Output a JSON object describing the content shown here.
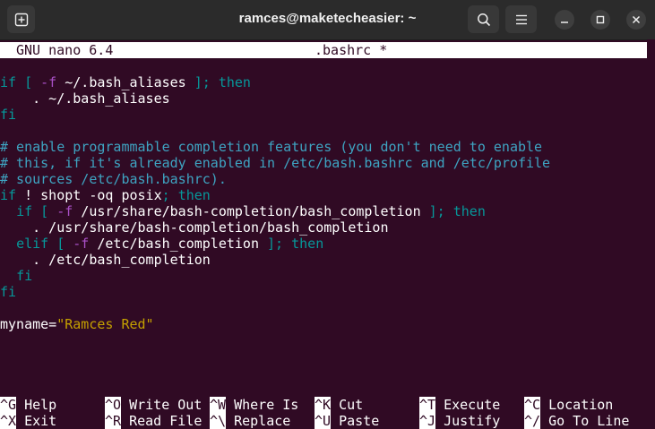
{
  "window": {
    "title": "ramces@maketecheasier: ~"
  },
  "nano": {
    "version_label": "GNU nano 6.4",
    "filename": ".bashrc *"
  },
  "lines": [
    [
      {
        "t": "if",
        "c": "c-kw"
      },
      {
        "t": " "
      },
      {
        "t": "[",
        "c": "c-br"
      },
      {
        "t": " "
      },
      {
        "t": "-f",
        "c": "c-flag"
      },
      {
        "t": " ~/.bash_aliases "
      },
      {
        "t": "];",
        "c": "c-br"
      },
      {
        "t": " "
      },
      {
        "t": "then",
        "c": "c-kw"
      }
    ],
    [
      {
        "t": "    . ~/.bash_aliases"
      }
    ],
    [
      {
        "t": "fi",
        "c": "c-fi"
      }
    ],
    [
      {
        "t": ""
      }
    ],
    [
      {
        "t": "# enable programmable completion features (you don't need to enable",
        "c": "c-cmt"
      }
    ],
    [
      {
        "t": "# this, if it's already enabled in /etc/bash.bashrc and /etc/profile",
        "c": "c-cmt"
      }
    ],
    [
      {
        "t": "# sources /etc/bash.bashrc).",
        "c": "c-cmt"
      }
    ],
    [
      {
        "t": "if",
        "c": "c-kw"
      },
      {
        "t": " ! shopt -oq posix"
      },
      {
        "t": ";",
        "c": "c-br"
      },
      {
        "t": " "
      },
      {
        "t": "then",
        "c": "c-kw"
      }
    ],
    [
      {
        "t": "  "
      },
      {
        "t": "if",
        "c": "c-kw"
      },
      {
        "t": " "
      },
      {
        "t": "[",
        "c": "c-br"
      },
      {
        "t": " "
      },
      {
        "t": "-f",
        "c": "c-flag"
      },
      {
        "t": " /usr/share/bash-completion/bash_completion "
      },
      {
        "t": "];",
        "c": "c-br"
      },
      {
        "t": " "
      },
      {
        "t": "then",
        "c": "c-kw"
      }
    ],
    [
      {
        "t": "    . /usr/share/bash-completion/bash_completion"
      }
    ],
    [
      {
        "t": "  "
      },
      {
        "t": "elif",
        "c": "c-kw"
      },
      {
        "t": " "
      },
      {
        "t": "[",
        "c": "c-br"
      },
      {
        "t": " "
      },
      {
        "t": "-f",
        "c": "c-flag"
      },
      {
        "t": " /etc/bash_completion "
      },
      {
        "t": "];",
        "c": "c-br"
      },
      {
        "t": " "
      },
      {
        "t": "then",
        "c": "c-kw"
      }
    ],
    [
      {
        "t": "    . /etc/bash_completion"
      }
    ],
    [
      {
        "t": "  "
      },
      {
        "t": "fi",
        "c": "c-fi"
      }
    ],
    [
      {
        "t": "fi",
        "c": "c-fi"
      }
    ],
    [
      {
        "t": ""
      }
    ],
    [
      {
        "t": "myname="
      },
      {
        "t": "\"Ramces Red\"",
        "c": "c-str"
      }
    ]
  ],
  "shortcuts": [
    [
      {
        "key": "^G",
        "label": " Help"
      },
      {
        "key": "^O",
        "label": " Write Out"
      },
      {
        "key": "^W",
        "label": " Where Is"
      },
      {
        "key": "^K",
        "label": " Cut"
      },
      {
        "key": "^T",
        "label": " Execute"
      },
      {
        "key": "^C",
        "label": " Location"
      }
    ],
    [
      {
        "key": "^X",
        "label": " Exit"
      },
      {
        "key": "^R",
        "label": " Read File"
      },
      {
        "key": "^\\",
        "label": " Replace"
      },
      {
        "key": "^U",
        "label": " Paste"
      },
      {
        "key": "^J",
        "label": " Justify"
      },
      {
        "key": "^/",
        "label": " Go To Line"
      }
    ]
  ],
  "colors": {
    "terminal_bg": "#300a24",
    "keyword": "#06989a",
    "flag": "#a950c6",
    "string": "#c4a000",
    "comment": "#3ea4c2"
  },
  "icons": {
    "new_tab": "new-tab-icon",
    "search": "search-icon",
    "menu": "hamburger-menu-icon",
    "minimize": "minimize-icon",
    "maximize": "maximize-icon",
    "close": "close-icon"
  }
}
